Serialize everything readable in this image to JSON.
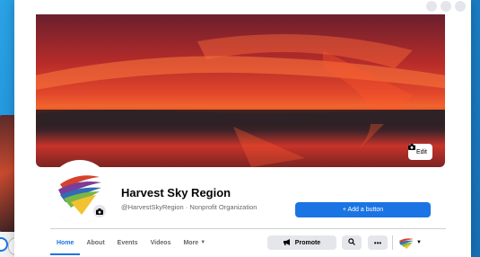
{
  "cover": {
    "edit_label": "Edit"
  },
  "profile": {
    "name": "Harvest Sky Region",
    "subtitle": "@HarvestSkyRegion · Nonprofit Organization"
  },
  "actions": {
    "add_button_label": "+ Add a button",
    "promote_label": "Promote"
  },
  "tabs": [
    {
      "label": "Home",
      "active": true
    },
    {
      "label": "About",
      "active": false
    },
    {
      "label": "Events",
      "active": false
    },
    {
      "label": "Videos",
      "active": false
    },
    {
      "label": "More",
      "active": false
    }
  ],
  "colors": {
    "accent": "#1b74e4",
    "cover_orange": "#e54b22",
    "logo_green": "#7ab648",
    "logo_yellow": "#f2c230",
    "logo_red": "#d6422b",
    "logo_blue": "#2f6db5",
    "logo_purple": "#7a3d98"
  }
}
